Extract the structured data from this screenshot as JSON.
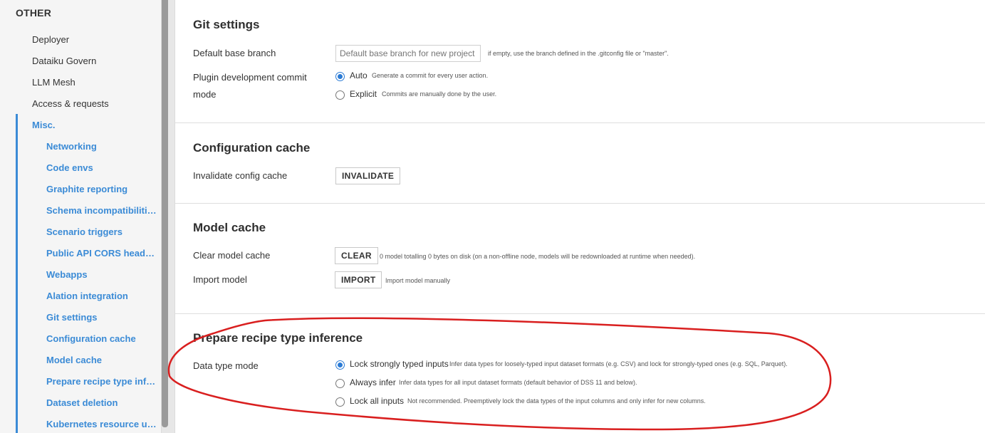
{
  "sidebar": {
    "heading": "OTHER",
    "items": [
      {
        "label": "Deployer"
      },
      {
        "label": "Dataiku Govern"
      },
      {
        "label": "LLM Mesh"
      },
      {
        "label": "Access & requests"
      },
      {
        "label": "Misc."
      }
    ],
    "subitems": [
      {
        "label": "Networking"
      },
      {
        "label": "Code envs"
      },
      {
        "label": "Graphite reporting"
      },
      {
        "label": "Schema incompatibilities"
      },
      {
        "label": "Scenario triggers"
      },
      {
        "label": "Public API CORS headers"
      },
      {
        "label": "Webapps"
      },
      {
        "label": "Alation integration"
      },
      {
        "label": "Git settings"
      },
      {
        "label": "Configuration cache"
      },
      {
        "label": "Model cache"
      },
      {
        "label": "Prepare recipe type inf…"
      },
      {
        "label": "Dataset deletion"
      },
      {
        "label": "Kubernetes resource us…"
      }
    ]
  },
  "git": {
    "title": "Git settings",
    "default_branch_label": "Default base branch",
    "default_branch_placeholder": "Default base branch for new project",
    "default_branch_value": "",
    "default_branch_hint": "if empty, use the branch defined in the .gitconfig file or \"master\".",
    "commit_mode_label_1": "Plugin development commit",
    "commit_mode_label_2": "mode",
    "auto_label": "Auto",
    "auto_hint": "Generate a commit for every user action.",
    "explicit_label": "Explicit",
    "explicit_hint": "Commits are manually done by the user."
  },
  "config_cache": {
    "title": "Configuration cache",
    "invalidate_label": "Invalidate config cache",
    "invalidate_button": "INVALIDATE"
  },
  "model_cache": {
    "title": "Model cache",
    "clear_label": "Clear model cache",
    "clear_button": "CLEAR",
    "clear_hint": "0 model totalling 0 bytes on disk (on a non-offline node, models will be redownloaded at runtime when needed).",
    "import_label": "Import model",
    "import_button": "IMPORT",
    "import_hint": "Import model manually"
  },
  "prepare": {
    "title": "Prepare recipe type inference",
    "mode_label": "Data type mode",
    "opt1_label": "Lock strongly typed inputs",
    "opt1_hint": "Infer data types for loosely-typed input dataset formats (e.g. CSV) and lock for strongly-typed ones (e.g. SQL, Parquet).",
    "opt2_label": "Always infer",
    "opt2_hint": "Infer data types for all input dataset formats (default behavior of DSS 11 and below).",
    "opt3_label": "Lock all inputs",
    "opt3_hint": "Not recommended. Preemptively lock the data types of the input columns and only infer for new columns."
  },
  "colors": {
    "accent": "#3b8bd6",
    "annotation": "#d91f1f"
  }
}
